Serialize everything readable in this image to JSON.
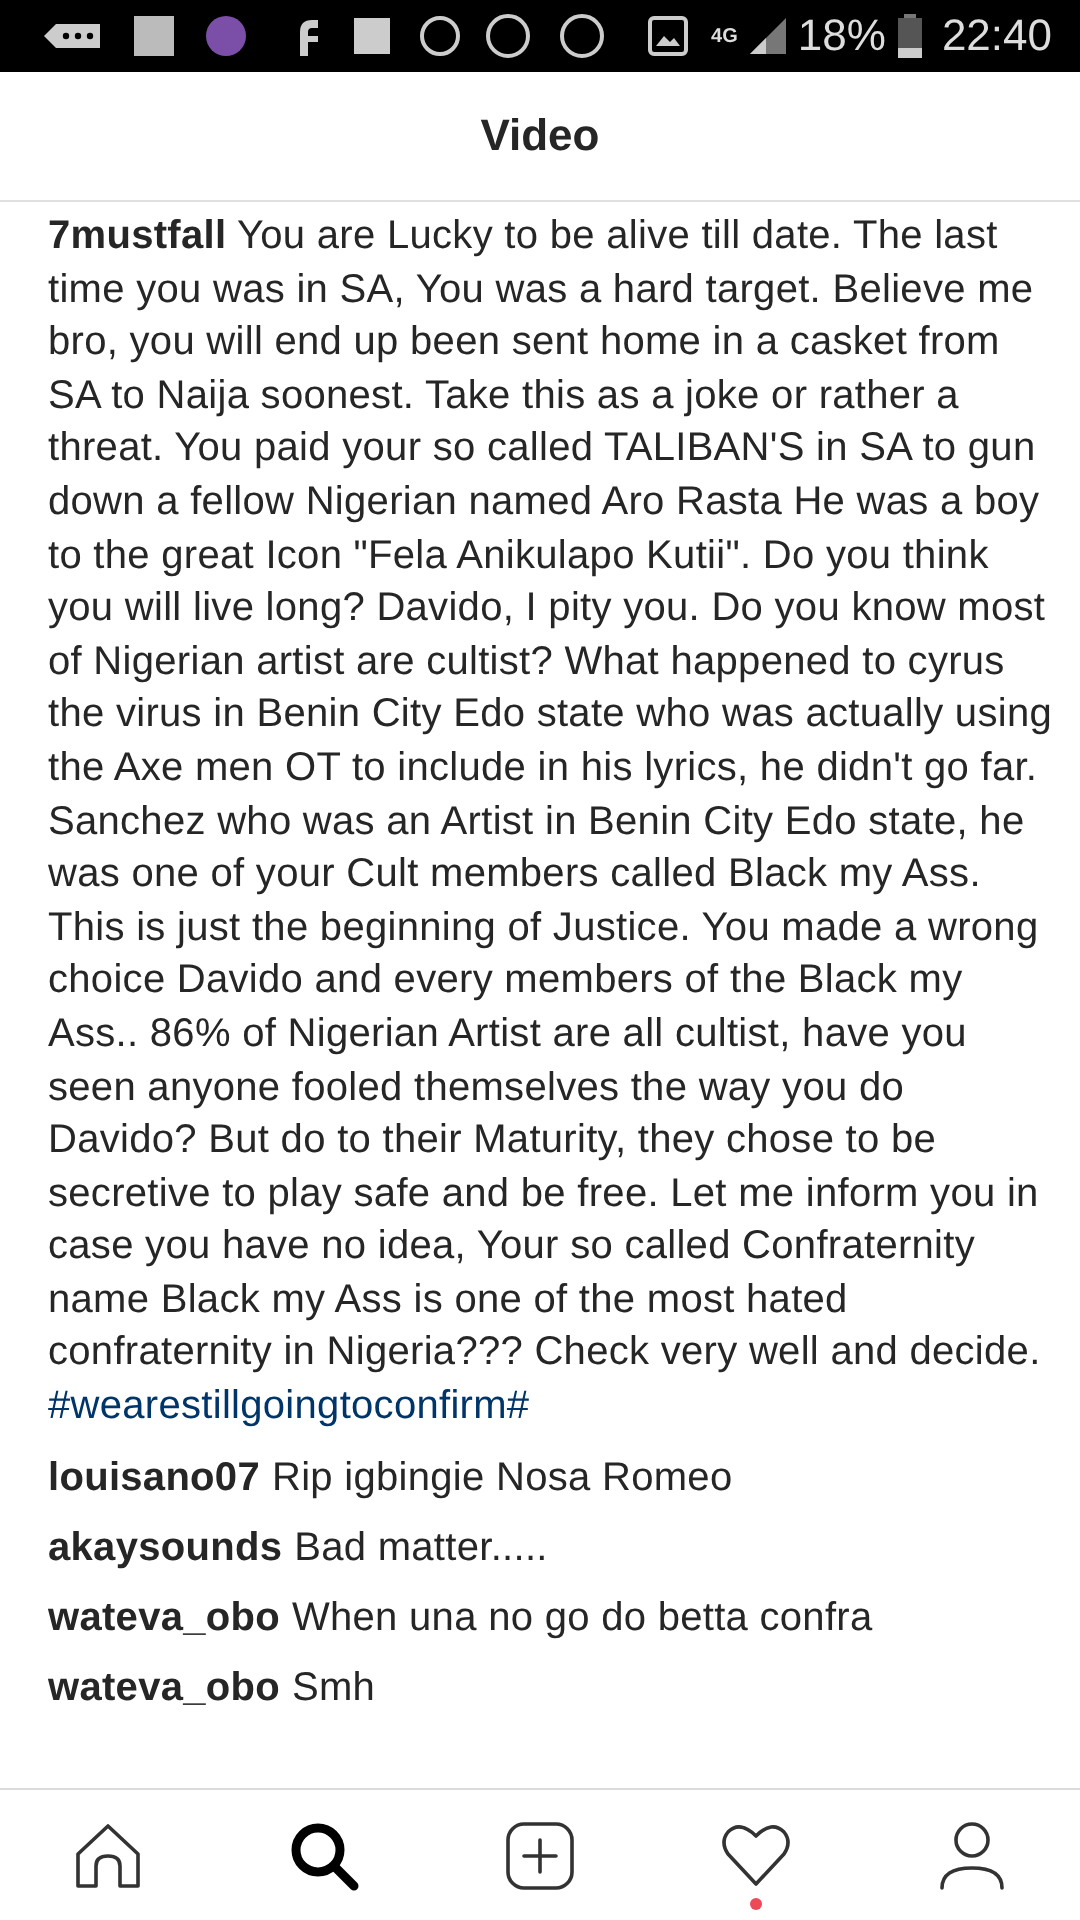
{
  "status_bar": {
    "network": "4G",
    "battery": "18%",
    "time": "22:40"
  },
  "header": {
    "title": "Video"
  },
  "caption": {
    "text": "**7mustfall** You are Lucky to be alive till date. The last time you was in SA, You was a hard target. Believe me bro, you will end up been sent home in a casket from SA to Naija soonest. Take this as a joke or rather a threat. You paid your so called TALIBAN'S in SA to gun down a fellow Nigerian named Aro Rasta He was a boy to the great Icon \"Fela Anikulapo Kutii\". Do you think you will live long? Davido, I pity you. Do you know most of Nigerian artist are cultist? What happened to cyrus the virus in Benin City Edo state who was actually using the Axe men OT to include in his lyrics, he didn't go far. Sanchez who was an Artist in Benin City Edo state, he was one of your Cult members called Black my Ass. This is just the beginning of Justice. You made a wrong choice Davido and every members of the Black my Ass.. 86% of Nigerian Artist are all cultist, have you seen anyone fooled themselves the way you do Davido? But do to their Maturity, they chose to be secretive to play safe and be free. Let me inform you in case you have no idea, Your so called Confraternity name Black my Ass is one of the most hated confraternity in Nigeria??? Check very well and decide.",
    "hashtag": "#wearestillgoingtoconfirm#"
  },
  "comments": [
    {
      "username": "louisano07",
      "text": "Rip igbingie Nosa Romeo"
    },
    {
      "username": "akaysounds",
      "text": "Bad matter....."
    },
    {
      "username": "wateva_obo",
      "text": "When una no go do betta confra"
    },
    {
      "username": "wateva_obo",
      "text": "Smh"
    }
  ],
  "nav": [
    {
      "kind": "home",
      "selected": false,
      "badge": false
    },
    {
      "kind": "search",
      "selected": true,
      "badge": false
    },
    {
      "kind": "add",
      "selected": false,
      "badge": false
    },
    {
      "kind": "heart",
      "selected": false,
      "badge": true
    },
    {
      "kind": "profile",
      "selected": false,
      "badge": false
    }
  ]
}
